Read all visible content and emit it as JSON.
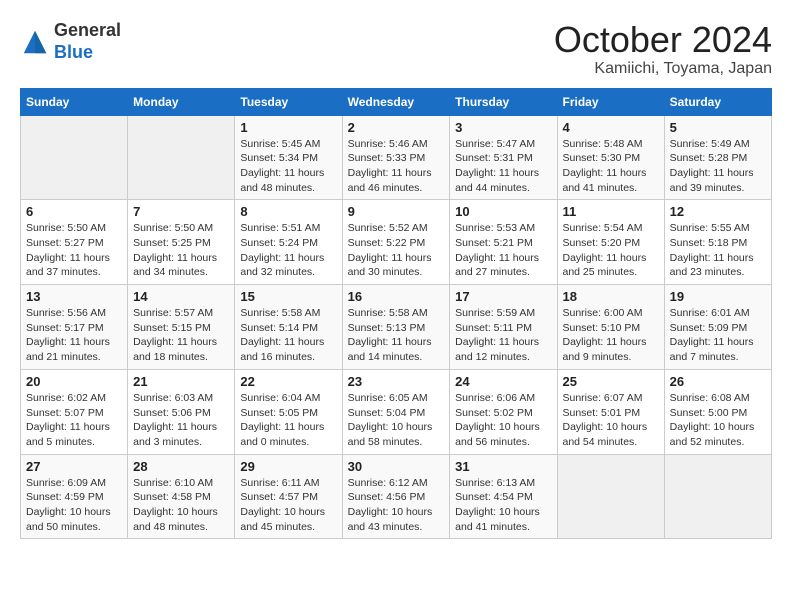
{
  "header": {
    "logo_line1": "General",
    "logo_line2": "Blue",
    "title": "October 2024",
    "subtitle": "Kamiichi, Toyama, Japan"
  },
  "columns": [
    "Sunday",
    "Monday",
    "Tuesday",
    "Wednesday",
    "Thursday",
    "Friday",
    "Saturday"
  ],
  "weeks": [
    [
      {
        "day": "",
        "info": ""
      },
      {
        "day": "",
        "info": ""
      },
      {
        "day": "1",
        "info": "Sunrise: 5:45 AM\nSunset: 5:34 PM\nDaylight: 11 hours and 48 minutes."
      },
      {
        "day": "2",
        "info": "Sunrise: 5:46 AM\nSunset: 5:33 PM\nDaylight: 11 hours and 46 minutes."
      },
      {
        "day": "3",
        "info": "Sunrise: 5:47 AM\nSunset: 5:31 PM\nDaylight: 11 hours and 44 minutes."
      },
      {
        "day": "4",
        "info": "Sunrise: 5:48 AM\nSunset: 5:30 PM\nDaylight: 11 hours and 41 minutes."
      },
      {
        "day": "5",
        "info": "Sunrise: 5:49 AM\nSunset: 5:28 PM\nDaylight: 11 hours and 39 minutes."
      }
    ],
    [
      {
        "day": "6",
        "info": "Sunrise: 5:50 AM\nSunset: 5:27 PM\nDaylight: 11 hours and 37 minutes."
      },
      {
        "day": "7",
        "info": "Sunrise: 5:50 AM\nSunset: 5:25 PM\nDaylight: 11 hours and 34 minutes."
      },
      {
        "day": "8",
        "info": "Sunrise: 5:51 AM\nSunset: 5:24 PM\nDaylight: 11 hours and 32 minutes."
      },
      {
        "day": "9",
        "info": "Sunrise: 5:52 AM\nSunset: 5:22 PM\nDaylight: 11 hours and 30 minutes."
      },
      {
        "day": "10",
        "info": "Sunrise: 5:53 AM\nSunset: 5:21 PM\nDaylight: 11 hours and 27 minutes."
      },
      {
        "day": "11",
        "info": "Sunrise: 5:54 AM\nSunset: 5:20 PM\nDaylight: 11 hours and 25 minutes."
      },
      {
        "day": "12",
        "info": "Sunrise: 5:55 AM\nSunset: 5:18 PM\nDaylight: 11 hours and 23 minutes."
      }
    ],
    [
      {
        "day": "13",
        "info": "Sunrise: 5:56 AM\nSunset: 5:17 PM\nDaylight: 11 hours and 21 minutes."
      },
      {
        "day": "14",
        "info": "Sunrise: 5:57 AM\nSunset: 5:15 PM\nDaylight: 11 hours and 18 minutes."
      },
      {
        "day": "15",
        "info": "Sunrise: 5:58 AM\nSunset: 5:14 PM\nDaylight: 11 hours and 16 minutes."
      },
      {
        "day": "16",
        "info": "Sunrise: 5:58 AM\nSunset: 5:13 PM\nDaylight: 11 hours and 14 minutes."
      },
      {
        "day": "17",
        "info": "Sunrise: 5:59 AM\nSunset: 5:11 PM\nDaylight: 11 hours and 12 minutes."
      },
      {
        "day": "18",
        "info": "Sunrise: 6:00 AM\nSunset: 5:10 PM\nDaylight: 11 hours and 9 minutes."
      },
      {
        "day": "19",
        "info": "Sunrise: 6:01 AM\nSunset: 5:09 PM\nDaylight: 11 hours and 7 minutes."
      }
    ],
    [
      {
        "day": "20",
        "info": "Sunrise: 6:02 AM\nSunset: 5:07 PM\nDaylight: 11 hours and 5 minutes."
      },
      {
        "day": "21",
        "info": "Sunrise: 6:03 AM\nSunset: 5:06 PM\nDaylight: 11 hours and 3 minutes."
      },
      {
        "day": "22",
        "info": "Sunrise: 6:04 AM\nSunset: 5:05 PM\nDaylight: 11 hours and 0 minutes."
      },
      {
        "day": "23",
        "info": "Sunrise: 6:05 AM\nSunset: 5:04 PM\nDaylight: 10 hours and 58 minutes."
      },
      {
        "day": "24",
        "info": "Sunrise: 6:06 AM\nSunset: 5:02 PM\nDaylight: 10 hours and 56 minutes."
      },
      {
        "day": "25",
        "info": "Sunrise: 6:07 AM\nSunset: 5:01 PM\nDaylight: 10 hours and 54 minutes."
      },
      {
        "day": "26",
        "info": "Sunrise: 6:08 AM\nSunset: 5:00 PM\nDaylight: 10 hours and 52 minutes."
      }
    ],
    [
      {
        "day": "27",
        "info": "Sunrise: 6:09 AM\nSunset: 4:59 PM\nDaylight: 10 hours and 50 minutes."
      },
      {
        "day": "28",
        "info": "Sunrise: 6:10 AM\nSunset: 4:58 PM\nDaylight: 10 hours and 48 minutes."
      },
      {
        "day": "29",
        "info": "Sunrise: 6:11 AM\nSunset: 4:57 PM\nDaylight: 10 hours and 45 minutes."
      },
      {
        "day": "30",
        "info": "Sunrise: 6:12 AM\nSunset: 4:56 PM\nDaylight: 10 hours and 43 minutes."
      },
      {
        "day": "31",
        "info": "Sunrise: 6:13 AM\nSunset: 4:54 PM\nDaylight: 10 hours and 41 minutes."
      },
      {
        "day": "",
        "info": ""
      },
      {
        "day": "",
        "info": ""
      }
    ]
  ]
}
